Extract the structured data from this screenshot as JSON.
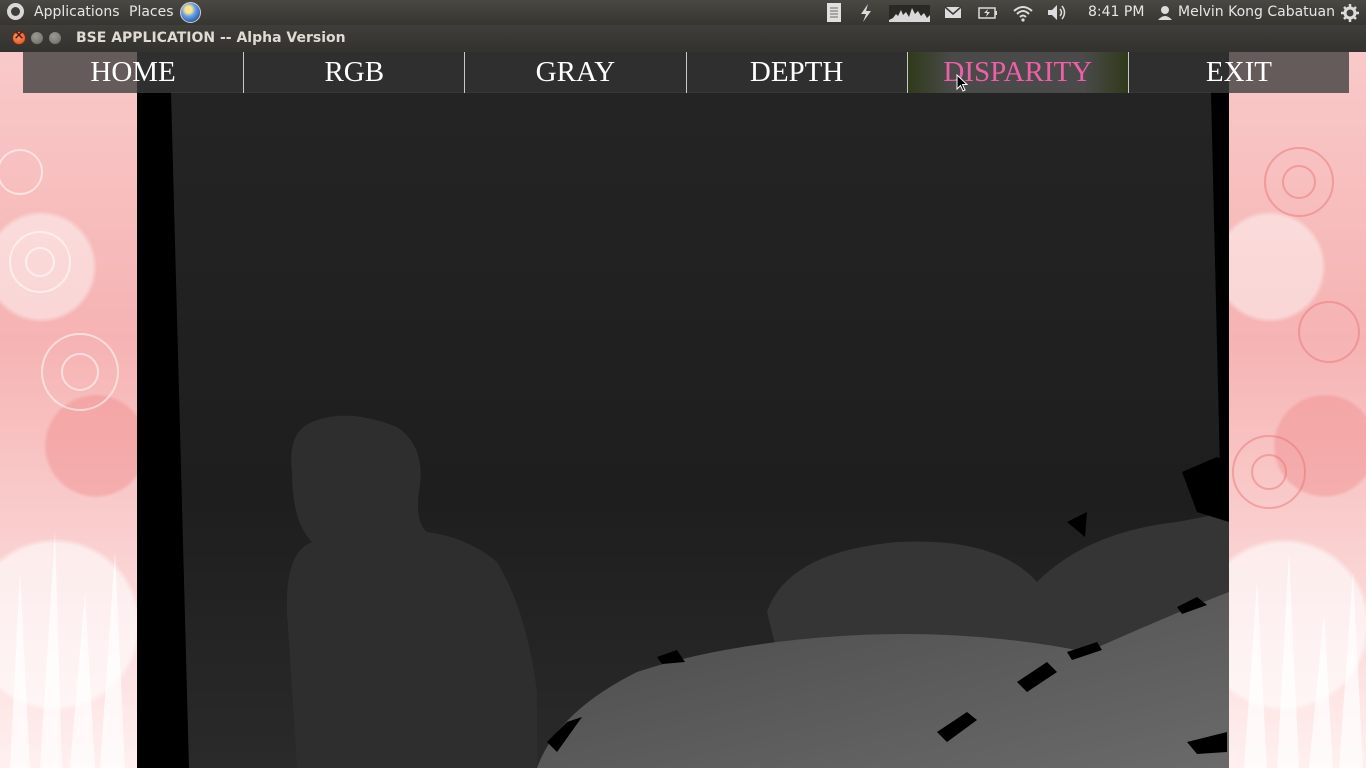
{
  "panel": {
    "applications": "Applications",
    "places": "Places",
    "time": "8:41 PM",
    "user": "Melvin Kong Cabatuan"
  },
  "window": {
    "title": "BSE APPLICATION -- Alpha Version"
  },
  "nav": {
    "items": [
      "HOME",
      "RGB",
      "GRAY",
      "DEPTH",
      "DISPARITY",
      "EXIT"
    ],
    "active": "DISPARITY"
  },
  "colors": {
    "nav_active_text": "#ee5fa8",
    "nav_text": "#ffffff",
    "background_pink": "#f7c3c3"
  },
  "icons": [
    "ubuntu-logo-icon",
    "globe-icon",
    "document-icon",
    "bolt-icon",
    "system-monitor-icon",
    "mail-icon",
    "battery-icon",
    "wifi-icon",
    "volume-icon",
    "user-icon",
    "power-gear-icon"
  ]
}
